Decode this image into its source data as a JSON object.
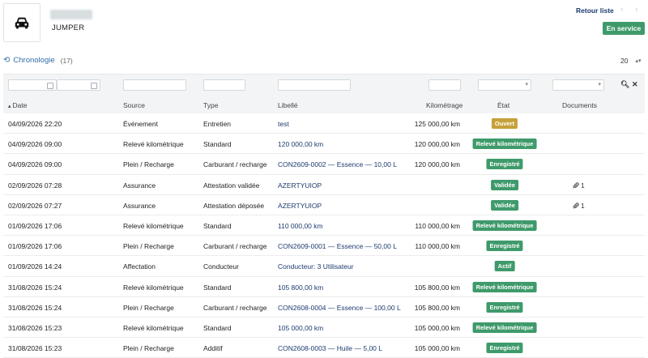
{
  "vehicle": {
    "name": "JUMPER",
    "icon": "car-icon"
  },
  "nav": {
    "back_label": "Retour liste",
    "prev": "‹",
    "next": "›"
  },
  "status": {
    "label": "En service",
    "color": "#3f9a6b"
  },
  "chronology": {
    "icon": "history-icon",
    "title": "Chronologie",
    "count": "(17)"
  },
  "pagination": {
    "page_size": "20"
  },
  "table": {
    "headers": {
      "date": "Date",
      "source": "Source",
      "type": "Type",
      "libelle": "Libellé",
      "km": "Kilométrage",
      "etat": "État",
      "docs": "Documents"
    },
    "rows": [
      {
        "date": "04/09/2026 22:20",
        "source": "Événement",
        "type": "Entretien",
        "libelle": "test",
        "km": "125 000,00 km",
        "etat": "Ouvert",
        "etat_color": "#c6a03a",
        "docs": ""
      },
      {
        "date": "04/09/2026 09:00",
        "source": "Relevé kilométrique",
        "type": "Standard",
        "libelle": "120 000,00 km",
        "km": "120 000,00 km",
        "etat": "Relevé kilométrique",
        "etat_color": "#3f9a6b",
        "docs": ""
      },
      {
        "date": "04/09/2026 09:00",
        "source": "Plein / Recharge",
        "type": "Carburant / recharge",
        "libelle": "CON2609-0002 — Essence — 10,00 L",
        "km": "120 000,00 km",
        "etat": "Enregistré",
        "etat_color": "#3f9a6b",
        "docs": ""
      },
      {
        "date": "02/09/2026 07:28",
        "source": "Assurance",
        "type": "Attestation validée",
        "libelle": "AZERTYUIOP",
        "km": "",
        "etat": "Validée",
        "etat_color": "#3f9a6b",
        "docs": "1"
      },
      {
        "date": "02/09/2026 07:27",
        "source": "Assurance",
        "type": "Attestation déposée",
        "libelle": "AZERTYUIOP",
        "km": "",
        "etat": "Validée",
        "etat_color": "#3f9a6b",
        "docs": "1"
      },
      {
        "date": "01/09/2026 17:06",
        "source": "Relevé kilométrique",
        "type": "Standard",
        "libelle": "110 000,00 km",
        "km": "110 000,00 km",
        "etat": "Relevé kilométrique",
        "etat_color": "#3f9a6b",
        "docs": ""
      },
      {
        "date": "01/09/2026 17:06",
        "source": "Plein / Recharge",
        "type": "Carburant / recharge",
        "libelle": "CON2609-0001 — Essence — 50,00 L",
        "km": "110 000,00 km",
        "etat": "Enregistré",
        "etat_color": "#3f9a6b",
        "docs": ""
      },
      {
        "date": "01/09/2026 14:24",
        "source": "Affectation",
        "type": "Conducteur",
        "libelle": "Conducteur: 3 Utilisateur",
        "km": "",
        "etat": "Actif",
        "etat_color": "#3f9a6b",
        "docs": ""
      },
      {
        "date": "31/08/2026 15:24",
        "source": "Relevé kilométrique",
        "type": "Standard",
        "libelle": "105 800,00 km",
        "km": "105 800,00 km",
        "etat": "Relevé kilométrique",
        "etat_color": "#3f9a6b",
        "docs": ""
      },
      {
        "date": "31/08/2026 15:24",
        "source": "Plein / Recharge",
        "type": "Carburant / recharge",
        "libelle": "CON2608-0004 — Essence — 100,00 L",
        "km": "105 800,00 km",
        "etat": "Enregistré",
        "etat_color": "#3f9a6b",
        "docs": ""
      },
      {
        "date": "31/08/2026 15:23",
        "source": "Relevé kilométrique",
        "type": "Standard",
        "libelle": "105 000,00 km",
        "km": "105 000,00 km",
        "etat": "Relevé kilométrique",
        "etat_color": "#3f9a6b",
        "docs": ""
      },
      {
        "date": "31/08/2026 15:23",
        "source": "Plein / Recharge",
        "type": "Additif",
        "libelle": "CON2608-0003 — Huile — 5,00 L",
        "km": "105 000,00 km",
        "etat": "Enregistré",
        "etat_color": "#3f9a6b",
        "docs": ""
      }
    ]
  }
}
